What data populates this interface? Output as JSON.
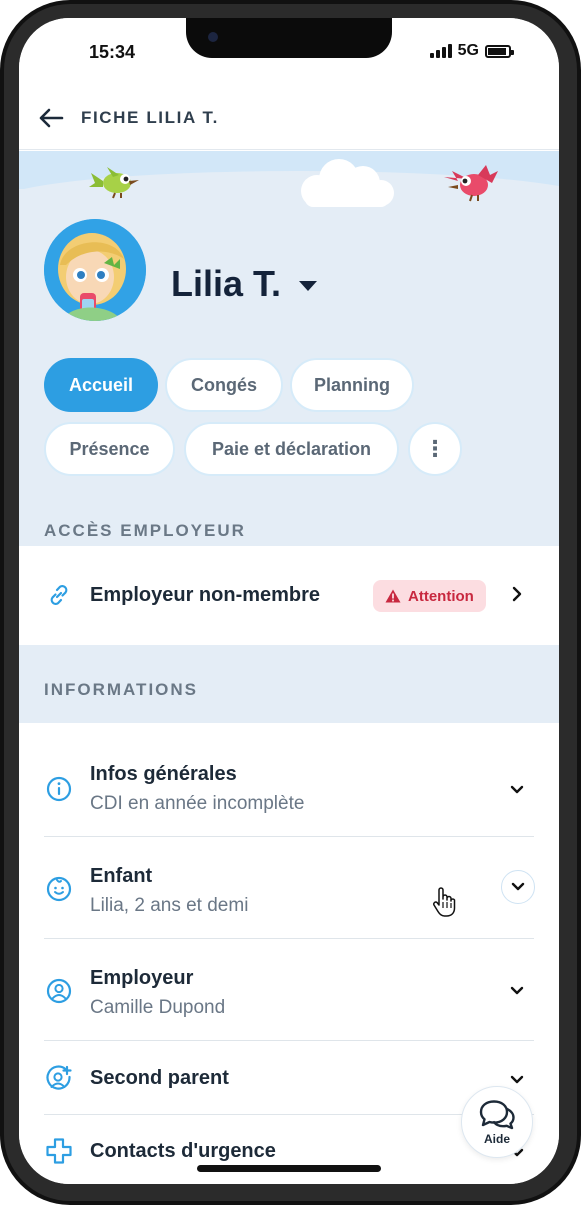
{
  "status_bar": {
    "time": "15:34",
    "network": "5G"
  },
  "header": {
    "title": "FICHE LILIA T.",
    "back_icon": "arrow-left-icon"
  },
  "profile": {
    "name": "Lilia T."
  },
  "tabs": {
    "accueil": "Accueil",
    "conges": "Congés",
    "planning": "Planning",
    "presence": "Présence",
    "paie": "Paie et déclaration",
    "more": "⋮",
    "active": "Accueil"
  },
  "employer_access": {
    "section_label": "ACCÈS EMPLOYEUR",
    "row_label": "Employeur non-membre",
    "badge": "Attention"
  },
  "informations": {
    "section_label": "INFORMATIONS",
    "items": [
      {
        "title": "Infos générales",
        "subtitle": "CDI en année incomplète",
        "icon": "info-icon"
      },
      {
        "title": "Enfant",
        "subtitle": "Lilia, 2 ans et demi",
        "icon": "child-face-icon"
      },
      {
        "title": "Employeur",
        "subtitle": "Camille Dupond",
        "icon": "user-circle-icon"
      },
      {
        "title": "Second parent",
        "subtitle": "",
        "icon": "user-plus-icon"
      },
      {
        "title": "Contacts d'urgence",
        "subtitle": "",
        "icon": "plus-cross-icon"
      }
    ]
  },
  "help": {
    "label": "Aide"
  },
  "colors": {
    "accent": "#2d9ee2",
    "hero_bg": "#e4edf6",
    "warning_bg": "#fcdde1",
    "warning_text": "#c8283f",
    "title_text": "#14233a"
  }
}
